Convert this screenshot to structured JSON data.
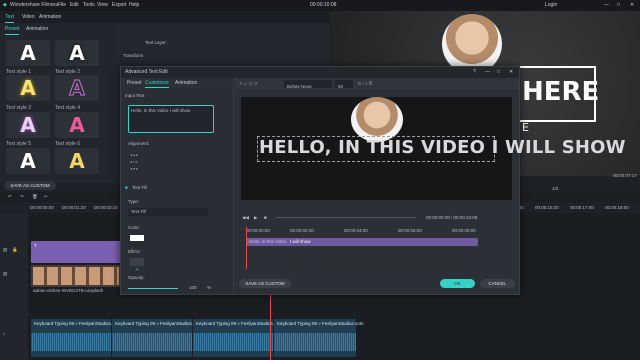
{
  "app": {
    "title": "Wondershare Filmora",
    "menu": [
      "File",
      "Edit",
      "Tools",
      "View",
      "Export",
      "Help"
    ],
    "timecode": "00:00:10:08",
    "login": "Login"
  },
  "top_tabs": [
    "Text",
    "Video",
    "Animation"
  ],
  "sub_tabs": [
    "Preset",
    "Animation"
  ],
  "text_styles": [
    "Text style 1",
    "Text style 2",
    "Text style 3",
    "Text style 4",
    "Text style 5",
    "Text style 6",
    "",
    ""
  ],
  "text_panel": {
    "text_layer": "Text Layer:",
    "transform": "Transform"
  },
  "save_as_custom_main": "SAVE AS CUSTOM",
  "preview": {
    "overlay_text": "HERE",
    "overlay_sub": "E",
    "time": "00:00:07:17",
    "page": "1/2"
  },
  "dialog": {
    "title": "Advanced Text Edit",
    "tabs": [
      "Preset",
      "Customize",
      "Animation"
    ],
    "input_text_header": "Input Text",
    "input_value": "Hello, In this Video I will show",
    "alignment_label": "Alignment:",
    "text_fill_label": "Text Fill",
    "type_label": "Type:",
    "type_value": "Text Fill",
    "color_label": "Color:",
    "effect_label": "Effect:",
    "effect_value": "A",
    "opacity_label": "Opacity:",
    "opacity_value": "100",
    "opacity_unit": "%",
    "font_name": "Bebas Neue",
    "font_size": "60",
    "canvas_text": "HELLO, IN THIS VIDEO I WILL SHOW",
    "timecode": "00:00:00:00 / 00:00:10:08",
    "ruler": [
      "00:00:00:00",
      "00:00:02:00",
      "00:00:04:00",
      "00:00:06:00",
      "00:00:08:00",
      "00:00:10:00"
    ],
    "track_text_a": "Hello, In this Video",
    "track_text_b": "I will show",
    "save_as_custom": "SAVE AS CUSTOM",
    "ok": "OK",
    "cancel": "CANCEL",
    "accent": "#38d2c4"
  },
  "timeline": {
    "ruler": [
      "00:00:00:00",
      "00:00:01:20",
      "00:00:03:10",
      "00:00:15:00",
      "00:00:16:20",
      "00:00:17:00",
      "00:00:18:00",
      "00:00:19:20"
    ],
    "text_clip": "T",
    "video_clip_name": "adrian-olshan-WVBG2TB-unsplash",
    "audio_clips": [
      "Keyboard Typing 09 » FesliyanStudios.com",
      "Keyboard Typing 09 » FesliyanStudios.com",
      "Keyboard Typing 09 » FesliyanStudios.com",
      "Keyboard Typing 09 » FesliyanStudios.com"
    ]
  }
}
